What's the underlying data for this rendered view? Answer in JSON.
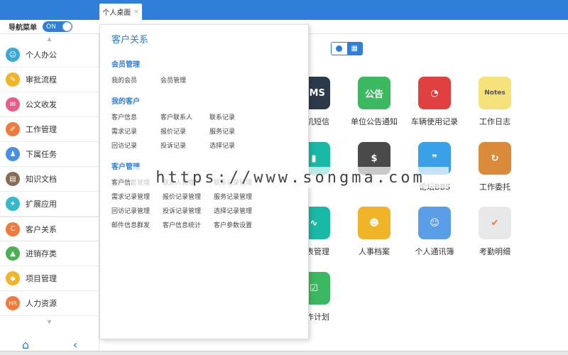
{
  "tabs": [
    {
      "label": "个人桌面",
      "close": "×"
    }
  ],
  "navhead": {
    "label": "导航菜单",
    "toggle": "ON"
  },
  "sidebar": {
    "items": [
      {
        "label": "个人办公",
        "icon": "person-icon",
        "color": "#3aa9d8",
        "glyph": "☺"
      },
      {
        "label": "审批流程",
        "icon": "approval-icon",
        "color": "#f0b429",
        "glyph": "✎"
      },
      {
        "label": "公文收发",
        "icon": "document-icon",
        "color": "#e85d8a",
        "glyph": "✉"
      },
      {
        "label": "工作管理",
        "icon": "work-icon",
        "color": "#f07a3c",
        "glyph": "✐"
      },
      {
        "label": "下属任务",
        "icon": "team-icon",
        "color": "#4a8fe0",
        "glyph": "♟"
      },
      {
        "label": "知识文档",
        "icon": "book-icon",
        "color": "#8a6b55",
        "glyph": "▤"
      },
      {
        "label": "扩展应用",
        "icon": "extension-icon",
        "color": "#33b9c9",
        "glyph": "✦"
      },
      {
        "label": "客户关系",
        "icon": "crm-icon",
        "color": "#f07a3c",
        "glyph": "C"
      },
      {
        "label": "进销存类",
        "icon": "inventory-icon",
        "color": "#4cb050",
        "glyph": "▲"
      },
      {
        "label": "项目管理",
        "icon": "project-icon",
        "color": "#f0b429",
        "glyph": "◆"
      },
      {
        "label": "人力资源",
        "icon": "hr-icon",
        "color": "#f07a3c",
        "glyph": "HR"
      }
    ]
  },
  "popup": {
    "title": "客户关系",
    "sections": [
      {
        "title": "会员管理",
        "links": [
          "我的会员",
          "会员管理"
        ]
      },
      {
        "title": "我的客户",
        "links": [
          "客户信息",
          "客户联系人",
          "联系记录",
          "需求记录",
          "报价记录",
          "服务记录",
          "回访记录",
          "投诉记录",
          "选择记录"
        ]
      },
      {
        "title": "客户管理",
        "links": [
          "客户信息管理",
          "联系人管理",
          "联系记录管理",
          "需求记录管理",
          "报价记录管理",
          "服务记录管理",
          "回访记录管理",
          "投诉记录管理",
          "选择记录管理",
          "邮件信息群发",
          "客户信息统计",
          "客户参数设置"
        ]
      }
    ]
  },
  "apps": [
    {
      "label": "手机短信",
      "icon": "sms-icon",
      "color": "#2b3a4a",
      "glyph": "SMS"
    },
    {
      "label": "单位公告通知",
      "icon": "notice-icon",
      "color": "#3cb860",
      "glyph": "公告"
    },
    {
      "label": "车辆使用记录",
      "icon": "gauge-icon",
      "color": "#e04040",
      "glyph": "◔"
    },
    {
      "label": "工作日志",
      "icon": "notes-icon",
      "color": "#f6e27a",
      "glyph": "Notes"
    },
    {
      "label": "",
      "icon": "book-green-icon",
      "color": "#1ab8a6",
      "glyph": "▮"
    },
    {
      "label": "",
      "icon": "wallet-icon",
      "color": "#4a4a4a",
      "glyph": "$"
    },
    {
      "label": "论坛BBS",
      "icon": "quote-icon",
      "color": "#3aa0e8",
      "glyph": "❞"
    },
    {
      "label": "工作委托",
      "icon": "delegate-icon",
      "color": "#d98b3a",
      "glyph": "↻"
    },
    {
      "label": "报表管理",
      "icon": "chart-icon",
      "color": "#1ab8a6",
      "glyph": "∿"
    },
    {
      "label": "人事档案",
      "icon": "profile-icon",
      "color": "#f0b429",
      "glyph": "☻"
    },
    {
      "label": "个人通讯簿",
      "icon": "contacts-icon",
      "color": "#5b9ee8",
      "glyph": "☺"
    },
    {
      "label": "考勤明细",
      "icon": "calendar-icon",
      "color": "#e8e8e8",
      "glyph": "✔"
    },
    {
      "label": "工作计划",
      "icon": "checklist-icon",
      "color": "#3cb860",
      "glyph": "☑"
    }
  ],
  "watermark": "https://www.songma.com"
}
